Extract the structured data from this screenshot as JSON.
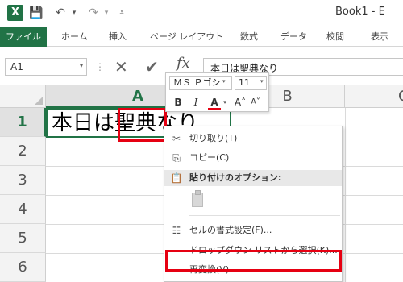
{
  "window": {
    "logo": "X",
    "title": "Book1 - E",
    "qat": {
      "save_icon": "💾",
      "undo_icon": "↶",
      "redo_icon": "↷",
      "dropdown_glyph": "▾",
      "customize_glyph": "⩡"
    }
  },
  "ribbon": {
    "tabs": [
      "ファイル",
      "ホーム",
      "挿入",
      "ページ レイアウト",
      "数式",
      "データ",
      "校閲",
      "表示"
    ],
    "active_color": "#217346"
  },
  "formula_bar": {
    "name_box": "A1",
    "name_box_dd": "▾",
    "separator": "⋮",
    "cancel_glyph": "✕",
    "enter_glyph": "✔",
    "fx_label": "fx",
    "formula": "本日は聖典なり"
  },
  "grid": {
    "columns": [
      "A",
      "B",
      "C"
    ],
    "rows": [
      "1",
      "2",
      "3",
      "4",
      "5",
      "6"
    ],
    "cell_a1": "本日は聖典なり"
  },
  "mini_toolbar": {
    "font": "ＭＳ Ｐゴシ",
    "font_dd": "▾",
    "size": "11",
    "size_dd": "▾",
    "bold": "B",
    "italic": "I",
    "font_color": "A",
    "font_color_dd": "▾",
    "grow_font": "A˄",
    "shrink_font": "A˅"
  },
  "context_menu": {
    "cut": {
      "icon": "✂",
      "label": "切り取り(T)"
    },
    "copy": {
      "icon": "⎘",
      "label": "コピー(C)"
    },
    "paste_options": {
      "icon": "📋",
      "label": "貼り付けのオプション:"
    },
    "format_cells": {
      "icon": "☷",
      "label": "セルの書式設定(F)..."
    },
    "dropdown_list": {
      "label": "ドロップダウン リストから選択(K)..."
    },
    "reconvert": {
      "label": "再変換(V)"
    }
  },
  "colors": {
    "excel_green": "#217346",
    "highlight_red": "#e60012"
  }
}
